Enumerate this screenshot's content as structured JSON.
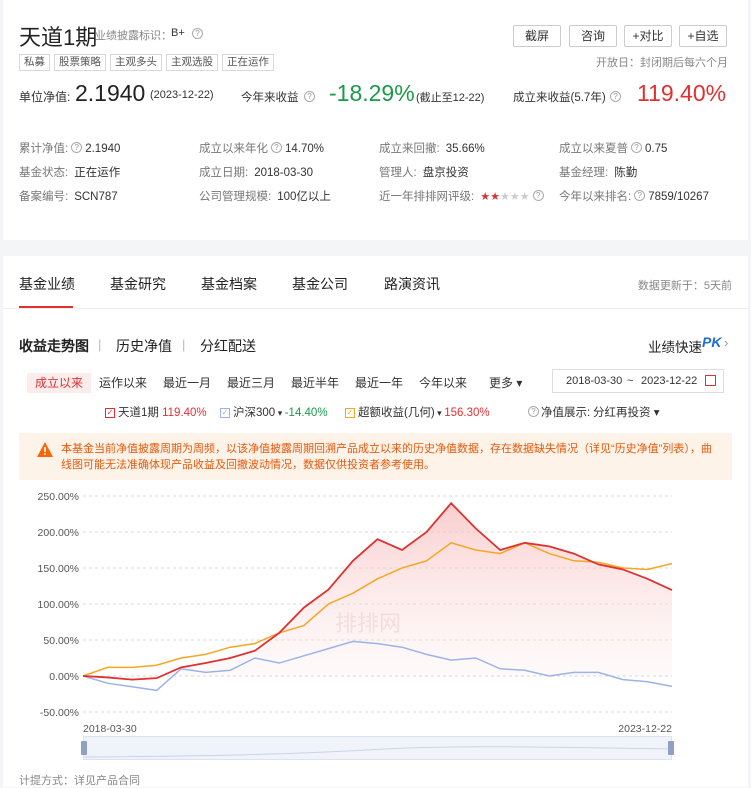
{
  "header": {
    "fund_name": "天道1期",
    "tag_label": "业绩披露标识：",
    "tag_value": "B+",
    "tags": [
      "私募",
      "股票策略",
      "主观多头",
      "主观选股",
      "正在运作"
    ],
    "buttons": [
      "截屏",
      "咨询",
      "+对比",
      "+自选"
    ],
    "open_day": "开放日：封闭期后每六个月"
  },
  "metrics": {
    "nav_label": "单位净值:",
    "nav_value": "2.1940",
    "nav_date": "(2023-12-22)",
    "ytd_label": "今年来收益",
    "ytd_value": "-18.29%",
    "ytd_note": "(截止至12-22)",
    "since_label": "成立来收益(5.7年)",
    "since_value": "119.40%"
  },
  "info": [
    [
      {
        "label": "累计净值:",
        "value": "2.1940",
        "q": true
      },
      {
        "label": "成立以来年化",
        "value": "14.70%",
        "q": true,
        "red": true
      },
      {
        "label": "成立来回撤:",
        "value": "35.66%"
      },
      {
        "label": "成立以来夏普",
        "value": "0.75",
        "q": true
      }
    ],
    [
      {
        "label": "基金状态:",
        "value": "正在运作"
      },
      {
        "label": "成立日期:",
        "value": "2018-03-30"
      },
      {
        "label": "管理人:",
        "value": "盘京投资",
        "blue": true
      },
      {
        "label": "基金经理:",
        "value": "陈勤",
        "blue": true
      }
    ],
    [
      {
        "label": "备案编号:",
        "value": "SCN787"
      },
      {
        "label": "公司管理规模:",
        "value": "100亿以上"
      },
      {
        "label": "近一年排排网评级:",
        "value": "",
        "stars": 2
      },
      {
        "label": "今年以来排名:",
        "value": "7859/10267",
        "q": true
      }
    ]
  ],
  "tabs": [
    "基金业绩",
    "基金研究",
    "基金档案",
    "基金公司",
    "路演资讯"
  ],
  "update_note": "数据更新于：5天前",
  "subtabs": [
    "收益走势图",
    "历史净值",
    "分红配送"
  ],
  "pk_label": "业绩快速",
  "pk_badge": "PK",
  "periods": [
    "成立以来",
    "运作以来",
    "最近一月",
    "最近三月",
    "最近半年",
    "最近一年",
    "今年以来",
    "更多"
  ],
  "date_range": {
    "start": "2018-03-30",
    "sep": "~",
    "end": "2023-12-22"
  },
  "legend": [
    {
      "name": "天道1期",
      "value": "119.40%",
      "color": "#e03131"
    },
    {
      "name": "沪深300",
      "value": "-14.40%",
      "color": "#9bb3e8"
    },
    {
      "name": "超额收益(几何)",
      "value": "156.30%",
      "color": "#f5a623"
    }
  ],
  "nav_display_label": "净值展示:",
  "nav_display_value": "分红再投资",
  "warning": "本基金当前净值披露周期为周频，以该净值披露周期回溯产品成立以来的历史净值数据，存在数据缺失情况（详见“历史净值”列表），曲线图可能无法准确体现产品收益及回撤波动情况，数据仅供投资者参考使用。",
  "watermark": "排排网",
  "footer": "计提方式：详见产品合同",
  "chart_data": {
    "type": "line",
    "title": "",
    "xlabel": "",
    "ylabel": "",
    "ylim": [
      -50,
      250
    ],
    "y_ticks": [
      "250.00%",
      "200.00%",
      "150.00%",
      "100.00%",
      "50.00%",
      "0.00%",
      "-50.00%"
    ],
    "y_tick_values": [
      250,
      200,
      150,
      100,
      50,
      0,
      -50
    ],
    "x_tick_labels": [
      "2018-03-30",
      "2023-12-22"
    ],
    "x": [
      "2018-03",
      "2018-06",
      "2018-09",
      "2018-12",
      "2019-03",
      "2019-06",
      "2019-09",
      "2019-12",
      "2020-03",
      "2020-06",
      "2020-09",
      "2020-12",
      "2021-02",
      "2021-04",
      "2021-06",
      "2021-09",
      "2021-12",
      "2022-03",
      "2022-06",
      "2022-09",
      "2022-12",
      "2023-03",
      "2023-06",
      "2023-09",
      "2023-12"
    ],
    "series": [
      {
        "name": "天道1期",
        "color": "#e03131",
        "fill": true,
        "values": [
          0,
          -2,
          -5,
          -3,
          12,
          18,
          25,
          35,
          60,
          95,
          120,
          160,
          190,
          175,
          200,
          240,
          205,
          175,
          185,
          180,
          170,
          155,
          148,
          135,
          119.4
        ]
      },
      {
        "name": "沪深300",
        "color": "#9bb3e8",
        "values": [
          0,
          -10,
          -15,
          -20,
          10,
          5,
          8,
          25,
          18,
          28,
          38,
          48,
          45,
          40,
          30,
          22,
          25,
          10,
          8,
          0,
          5,
          5,
          -5,
          -8,
          -14.4
        ]
      },
      {
        "name": "超额收益(几何)",
        "color": "#f5a623",
        "values": [
          0,
          12,
          12,
          15,
          25,
          30,
          40,
          45,
          60,
          70,
          100,
          115,
          135,
          150,
          160,
          185,
          175,
          170,
          185,
          170,
          160,
          158,
          150,
          148,
          156.3
        ]
      }
    ]
  }
}
